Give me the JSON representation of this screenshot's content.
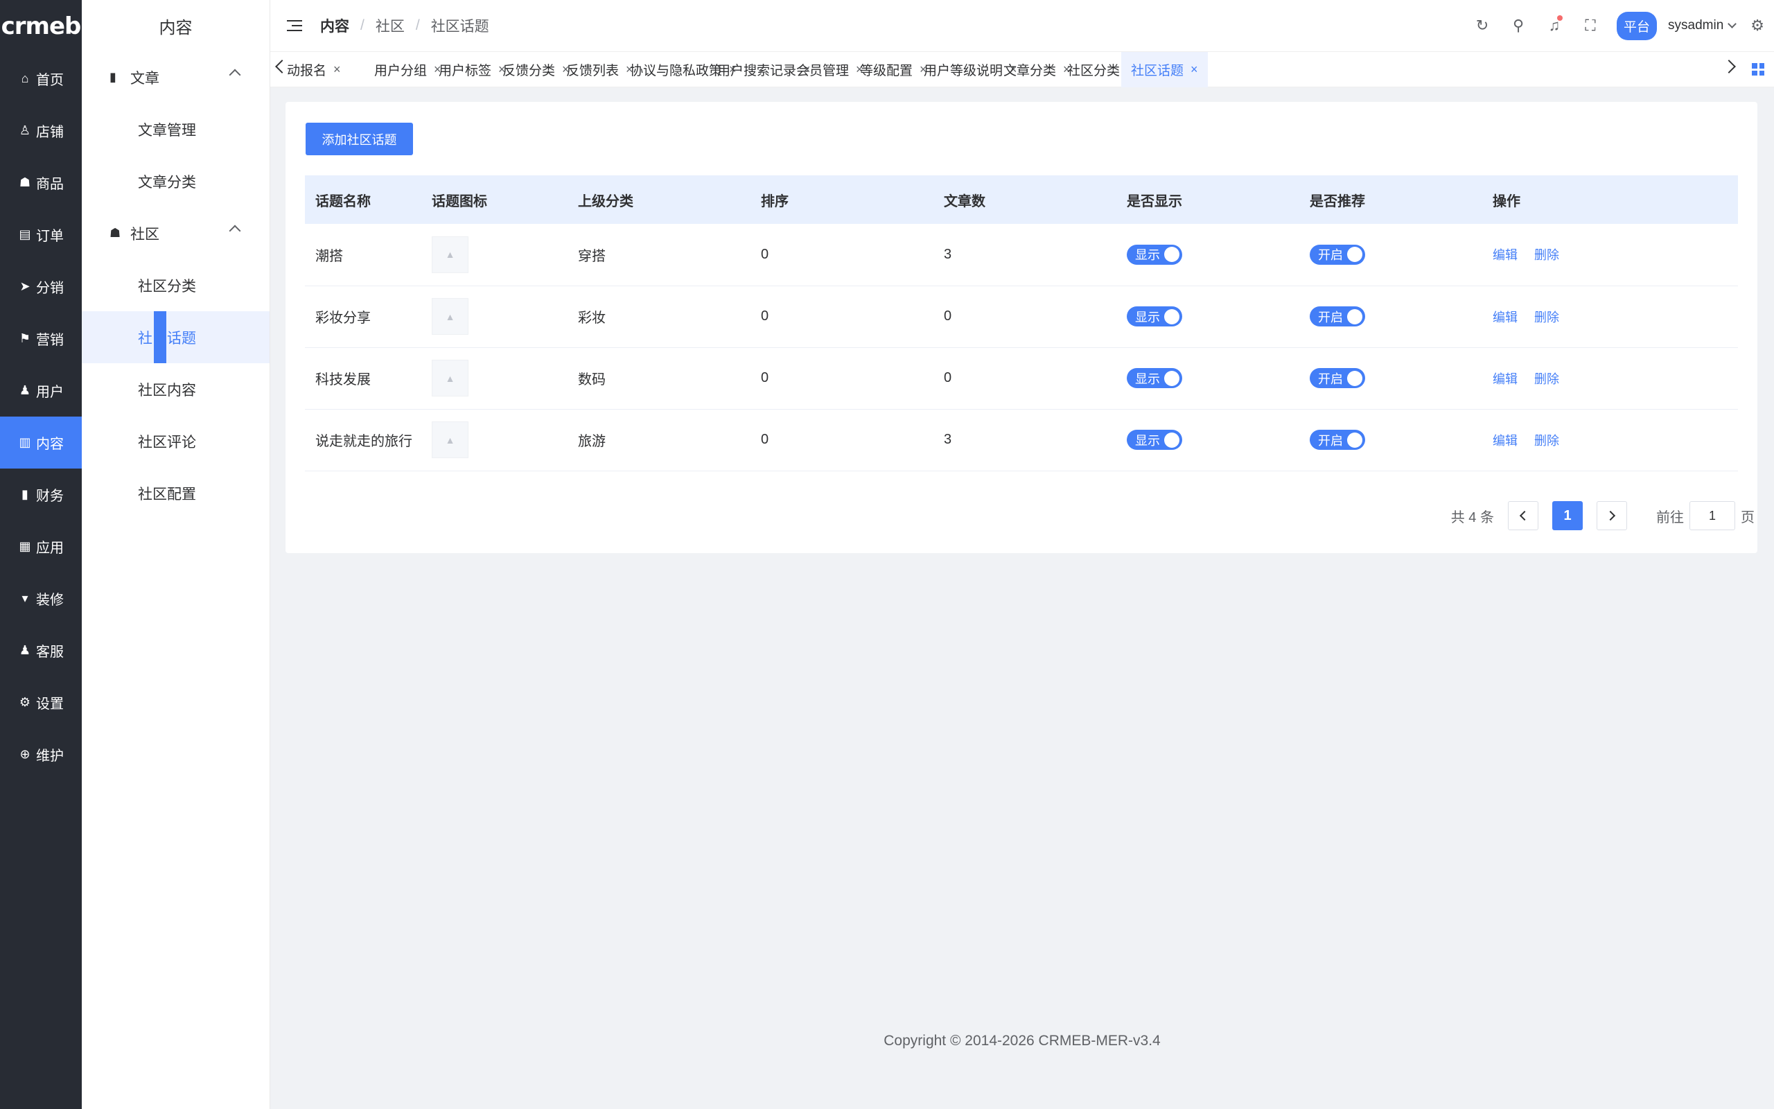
{
  "app": {
    "logo": "crmeb"
  },
  "rail": [
    {
      "label": "首页",
      "icon": "home-icon",
      "glyph": "⌂",
      "active": false
    },
    {
      "label": "店铺",
      "icon": "store-icon",
      "glyph": "♙",
      "active": false
    },
    {
      "label": "商品",
      "icon": "product-icon",
      "glyph": "☗",
      "active": false
    },
    {
      "label": "订单",
      "icon": "order-icon",
      "glyph": "▤",
      "active": false
    },
    {
      "label": "分销",
      "icon": "distribution-icon",
      "glyph": "➤",
      "active": false
    },
    {
      "label": "营销",
      "icon": "marketing-icon",
      "glyph": "⚑",
      "active": false
    },
    {
      "label": "用户",
      "icon": "user-icon",
      "glyph": "♟",
      "active": false
    },
    {
      "label": "内容",
      "icon": "content-icon",
      "glyph": "▥",
      "active": true
    },
    {
      "label": "财务",
      "icon": "finance-icon",
      "glyph": "▮",
      "active": false
    },
    {
      "label": "应用",
      "icon": "apps-icon",
      "glyph": "▦",
      "active": false
    },
    {
      "label": "装修",
      "icon": "decorate-icon",
      "glyph": "▾",
      "active": false
    },
    {
      "label": "客服",
      "icon": "service-icon",
      "glyph": "♟",
      "active": false
    },
    {
      "label": "设置",
      "icon": "settings-icon",
      "glyph": "⚙",
      "active": false
    },
    {
      "label": "维护",
      "icon": "maintenance-icon",
      "glyph": "⊕",
      "active": false
    }
  ],
  "submenu": {
    "title": "内容",
    "groups": [
      {
        "label": "文章",
        "icon": "article-icon",
        "items": [
          {
            "label": "文章管理"
          },
          {
            "label": "文章分类"
          }
        ]
      },
      {
        "label": "社区",
        "icon": "community-icon",
        "items": [
          {
            "label": "社区分类"
          },
          {
            "label": "社区话题",
            "active": true
          },
          {
            "label": "社区内容"
          },
          {
            "label": "社区评论"
          },
          {
            "label": "社区配置"
          }
        ]
      }
    ]
  },
  "header": {
    "breadcrumb": [
      "内容",
      "社区",
      "社区话题"
    ],
    "platform_label": "平台",
    "username": "sysadmin"
  },
  "tags": [
    {
      "label": "动报名",
      "active": false
    },
    {
      "label": "用户分组",
      "active": false
    },
    {
      "label": "用户标签",
      "active": false
    },
    {
      "label": "反馈分类",
      "active": false
    },
    {
      "label": "反馈列表",
      "active": false
    },
    {
      "label": "协议与隐私政策",
      "active": false
    },
    {
      "label": "用户搜索记录",
      "active": false
    },
    {
      "label": "会员管理",
      "active": false
    },
    {
      "label": "等级配置",
      "active": false
    },
    {
      "label": "用户等级说明",
      "active": false
    },
    {
      "label": "文章分类",
      "active": false
    },
    {
      "label": "社区分类",
      "active": false
    },
    {
      "label": "社区话题",
      "active": true
    }
  ],
  "main": {
    "add_button": "添加社区话题",
    "columns": [
      "话题名称",
      "话题图标",
      "上级分类",
      "排序",
      "文章数",
      "是否显示",
      "是否推荐",
      "操作"
    ],
    "rows": [
      {
        "name": "潮搭",
        "parent": "穿搭",
        "sort": "0",
        "count": "3",
        "show": "显示",
        "recommend": "开启"
      },
      {
        "name": "彩妆分享",
        "parent": "彩妆",
        "sort": "0",
        "count": "0",
        "show": "显示",
        "recommend": "开启"
      },
      {
        "name": "科技发展",
        "parent": "数码",
        "sort": "0",
        "count": "0",
        "show": "显示",
        "recommend": "开启"
      },
      {
        "name": "说走就走的旅行",
        "parent": "旅游",
        "sort": "0",
        "count": "3",
        "show": "显示",
        "recommend": "开启"
      }
    ],
    "actions": {
      "edit": "编辑",
      "delete": "删除"
    },
    "pagination": {
      "total": "共 4 条",
      "current": "1",
      "goto_label": "前往",
      "goto_value": "1",
      "page_suffix": "页"
    }
  },
  "footer": {
    "copyright": "Copyright © 2014-2026 CRMEB-MER-v3.4"
  },
  "colors": {
    "accent": "#437ef7",
    "rail_bg": "#282c34",
    "page_bg": "#f0f2f5",
    "header_row": "#e8f0fe"
  }
}
